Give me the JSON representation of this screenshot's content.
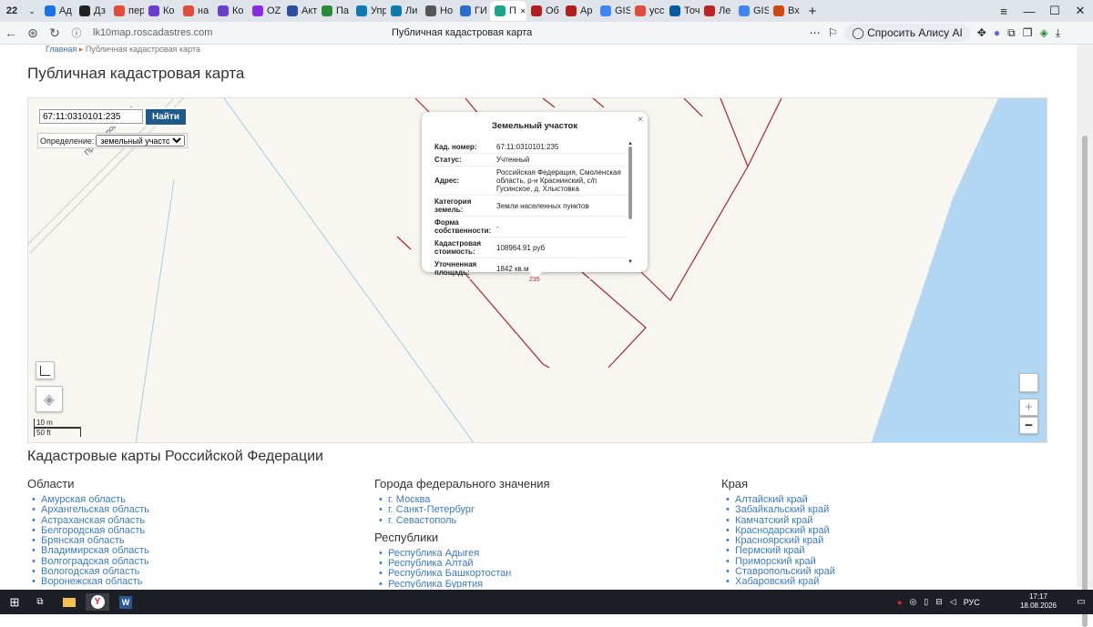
{
  "browser": {
    "tab_count": "22",
    "tabs": [
      {
        "label": "Ад",
        "color": "#1a73e8"
      },
      {
        "label": "Дз",
        "color": "#222222"
      },
      {
        "label": "пер",
        "color": "#e24c3c"
      },
      {
        "label": "Ко",
        "color": "#6a3fd0"
      },
      {
        "label": "на",
        "color": "#e24c3c"
      },
      {
        "label": "Ко",
        "color": "#6a3fd0"
      },
      {
        "label": "OZ",
        "color": "#8a2be2"
      },
      {
        "label": "Акт",
        "color": "#2a4fa0"
      },
      {
        "label": "Па",
        "color": "#2a8a3a"
      },
      {
        "label": "Упр",
        "color": "#0a7ab0"
      },
      {
        "label": "Ли",
        "color": "#0a7ab0"
      },
      {
        "label": "Но",
        "color": "#555555"
      },
      {
        "label": "ГИ",
        "color": "#2a6fd0"
      },
      {
        "label": "П",
        "color": "#19a68c",
        "active": true
      },
      {
        "label": "Об",
        "color": "#b01e1e"
      },
      {
        "label": "Ар",
        "color": "#b01e1e"
      },
      {
        "label": "GIS",
        "color": "#4285f4"
      },
      {
        "label": "усс",
        "color": "#e24c3c"
      },
      {
        "label": "Точ",
        "color": "#0a5aa0"
      },
      {
        "label": "Ле",
        "color": "#c02020"
      },
      {
        "label": "GIS",
        "color": "#4285f4"
      },
      {
        "label": "Вх",
        "color": "#d04a10"
      }
    ],
    "url": "lk10map.roscadastres.com",
    "page_title": "Публичная кадастровая карта",
    "alice_label": "Спросить Алису AI",
    "icons": [
      "back-icon",
      "refresh-icon",
      "more-icon",
      "bookmark-icon",
      "extension-icon"
    ]
  },
  "page": {
    "breadcrumb_home": "Главная",
    "breadcrumb_current": "Публичная кадастровая карта",
    "title": "Публичная кадастровая карта"
  },
  "map": {
    "search_value": "67:11:0310101:235",
    "search_button": "Найти",
    "definition_label": "Определение:",
    "definition_value": "земельный участок",
    "street_label": "Приднепровская ул.",
    "parcel_label": "235",
    "scale_m": "10 m",
    "scale_ft": "50 ft",
    "zoom_in": "+",
    "zoom_out": "−",
    "colors": {
      "parcel_line": "#b0232f",
      "water": "#b3d7f2",
      "background": "#f7f6f1"
    }
  },
  "popup": {
    "title": "Земельный участок",
    "close": "×",
    "rows": [
      {
        "k": "Кад. номер:",
        "v": "67:11:0310101:235"
      },
      {
        "k": "Статус:",
        "v": "Учтенный"
      },
      {
        "k": "Адрес:",
        "v": "Российская Федерация, Смоленская область, р-н Краснинский, с/п Гусинское, д. Хлыстовка"
      },
      {
        "k": "Категория земель:",
        "v": "Земли населенных пунктов"
      },
      {
        "k": "Форма собственности:",
        "v": "-"
      },
      {
        "k": "Кадастровая стоимость:",
        "v": "108964.91 руб"
      },
      {
        "k": "Уточненная площадь:",
        "v": "1842 кв.м"
      }
    ]
  },
  "directory": {
    "title": "Кадастровые карты Российской Федерации",
    "regions_title": "Области",
    "regions": [
      "Амурская область",
      "Архангельская область",
      "Астраханская область",
      "Белгородская область",
      "Брянская область",
      "Владимирская область",
      "Волгоградская область",
      "Вологодская область",
      "Воронежская область"
    ],
    "cities_title": "Города федерального значения",
    "cities": [
      "г. Москва",
      "г. Санкт-Петербург",
      "г. Севастополь"
    ],
    "republics_title": "Республики",
    "republics": [
      "Республика Адыгея",
      "Республика Алтай",
      "Республика Башкортостан",
      "Республика Бурятия"
    ],
    "krai_title": "Края",
    "krai": [
      "Алтайский край",
      "Забайкальский край",
      "Камчатский край",
      "Краснодарский край",
      "Красноярский край",
      "Пермский край",
      "Приморский край",
      "Ставропольский край",
      "Хабаровский край"
    ]
  },
  "taskbar": {
    "lang": "РУС",
    "time": "17:17",
    "date": "18.08.2026"
  }
}
